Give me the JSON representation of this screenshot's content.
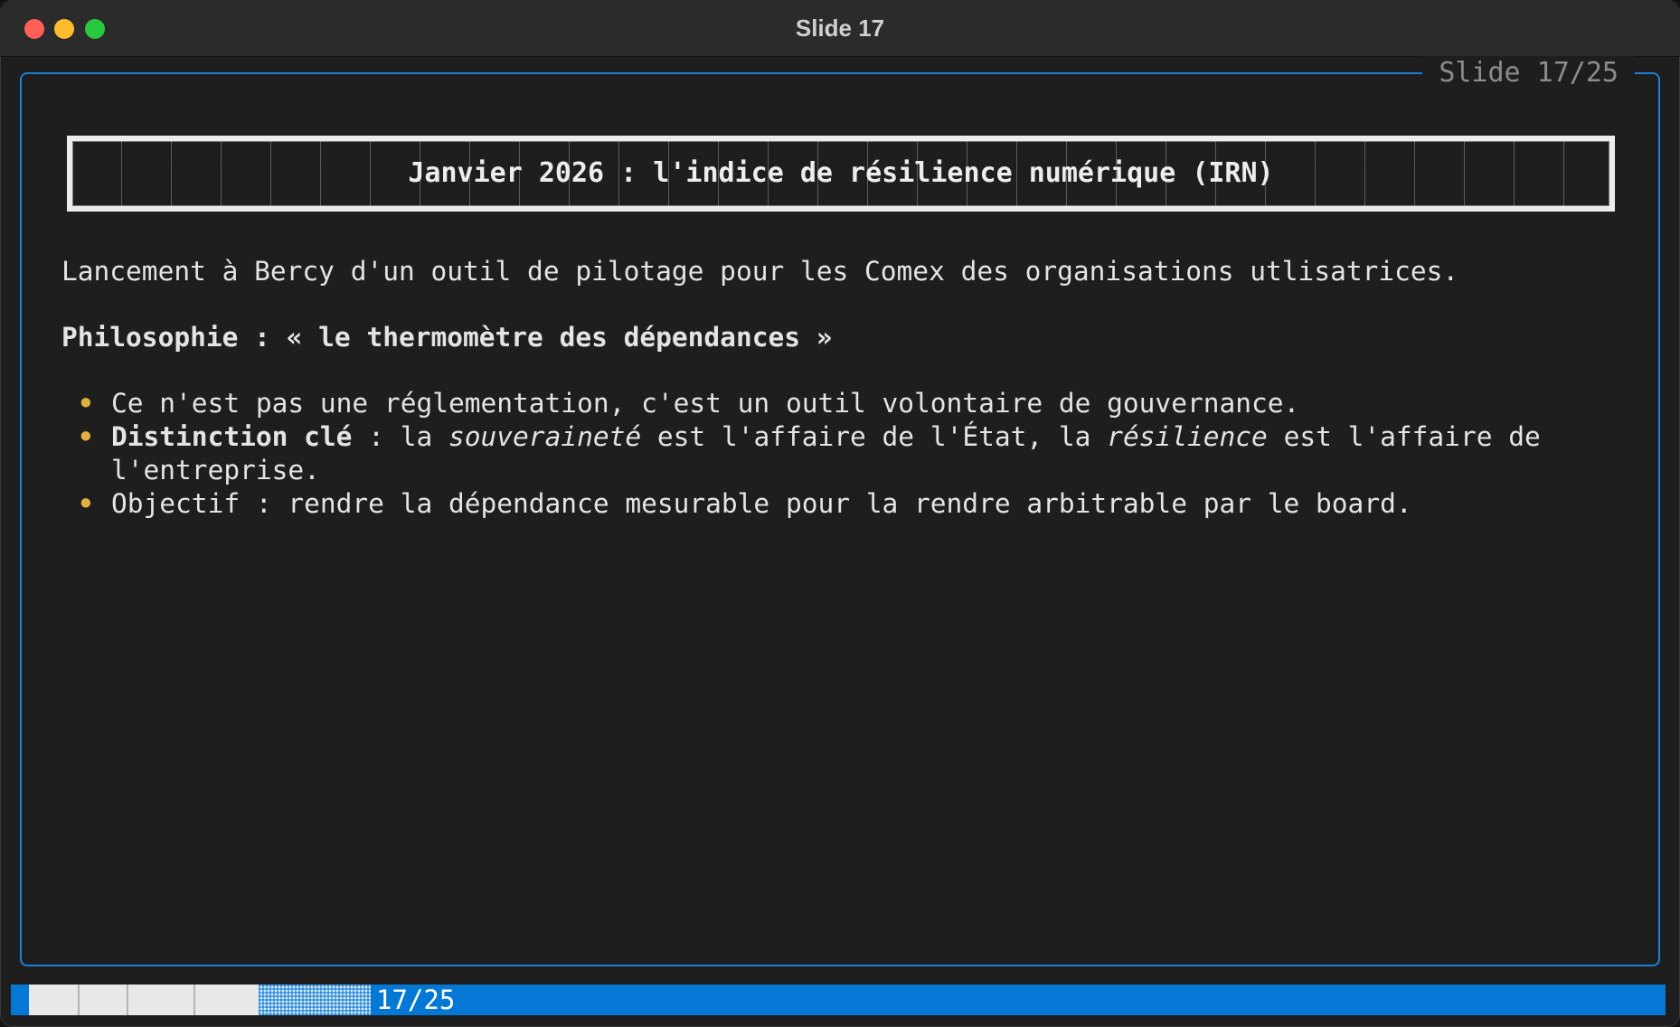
{
  "window": {
    "title": "Slide 17"
  },
  "slide": {
    "indicator": "Slide 17/25",
    "title": "Janvier 2026 : l'indice de résilience numérique (IRN)",
    "intro": "Lancement à Bercy d'un outil de pilotage pour les Comex des organisations utlisatrices.",
    "philosophy": "Philosophie : « le thermomètre des dépendances »",
    "bullets": [
      {
        "text": "Ce n'est pas une réglementation, c'est un outil volontaire de gouvernance."
      },
      {
        "bold": "Distinction clé",
        "part1": " : la ",
        "italic1": "souveraineté",
        "part2": " est l'affaire de l'État, la ",
        "italic2": "résilience",
        "part3": " est l'affaire de",
        "continuation": "l'entreprise."
      },
      {
        "text": "Objectif : rendre la dépendance mesurable pour la rendre arbitrable par le board."
      }
    ]
  },
  "status": {
    "counter": "17/25",
    "current_slide": 17,
    "total_slides": 25
  },
  "colors": {
    "accent_blue": "#0478d4",
    "frame_blue": "#1f7fd4",
    "bullet_gold": "#e0b040",
    "background": "#1e1e1e"
  }
}
